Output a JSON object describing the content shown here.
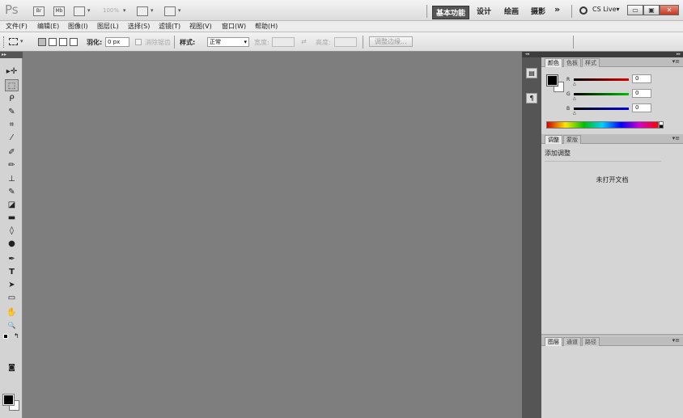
{
  "app": {
    "logo": "Ps"
  },
  "title_bar": {
    "br_label": "Br",
    "mb_label": "Mb",
    "zoom": "100%",
    "workspaces": [
      "基本功能",
      "设计",
      "绘画",
      "摄影"
    ],
    "more": "»",
    "cslive": "CS Live▾",
    "win_buttons": [
      "▭",
      "▣",
      "✕"
    ]
  },
  "menu": [
    "文件(F)",
    "编辑(E)",
    "图像(I)",
    "图层(L)",
    "选择(S)",
    "滤镜(T)",
    "视图(V)",
    "窗口(W)",
    "帮助(H)"
  ],
  "options": {
    "feather_label": "羽化:",
    "feather_value": "0 px",
    "antialias_label": "消除锯齿",
    "style_label": "样式:",
    "style_value": "正常",
    "width_label": "宽度:",
    "height_label": "高度:",
    "swap_icon": "⇄",
    "refine_button": "调整边缘..."
  },
  "tools": {
    "grip": "▸▸",
    "items": [
      {
        "name": "move",
        "glyph": "▸✛"
      },
      {
        "name": "marquee",
        "glyph": "⬚"
      },
      {
        "name": "lasso",
        "glyph": "ᑭ"
      },
      {
        "name": "quick-select",
        "glyph": "✎"
      },
      {
        "name": "crop",
        "glyph": "⌗"
      },
      {
        "name": "eyedropper",
        "glyph": "⁄"
      },
      {
        "name": "healing",
        "glyph": "✐"
      },
      {
        "name": "brush",
        "glyph": "✏"
      },
      {
        "name": "stamp",
        "glyph": "⊥"
      },
      {
        "name": "history-brush",
        "glyph": "✎"
      },
      {
        "name": "eraser",
        "glyph": "◪"
      },
      {
        "name": "gradient",
        "glyph": "▬"
      },
      {
        "name": "blur",
        "glyph": "◊"
      },
      {
        "name": "dodge",
        "glyph": "●"
      },
      {
        "name": "pen",
        "glyph": "✒"
      },
      {
        "name": "type",
        "glyph": "T"
      },
      {
        "name": "path-select",
        "glyph": "➤"
      },
      {
        "name": "shape",
        "glyph": "▭"
      },
      {
        "name": "hand",
        "glyph": "✋"
      },
      {
        "name": "zoom",
        "glyph": "🔍"
      }
    ],
    "quickmask": "◙"
  },
  "dock": {
    "header": "◂◂",
    "btn1": "▤",
    "btn2": "¶"
  },
  "panels": {
    "header": "▸▸",
    "color_tabs": [
      "颜色",
      "色板",
      "样式"
    ],
    "channels": [
      {
        "label": "R",
        "value": "0",
        "color": "#d01010"
      },
      {
        "label": "G",
        "value": "0",
        "color": "#10a010"
      },
      {
        "label": "B",
        "value": "0",
        "color": "#1010d0"
      }
    ],
    "adjust_tabs": [
      "调整",
      "蒙版"
    ],
    "adjust_title": "添加调整",
    "no_document": "未打开文档",
    "layer_tabs": [
      "图层",
      "通道",
      "路径"
    ],
    "menu_icon": "▾≡"
  }
}
